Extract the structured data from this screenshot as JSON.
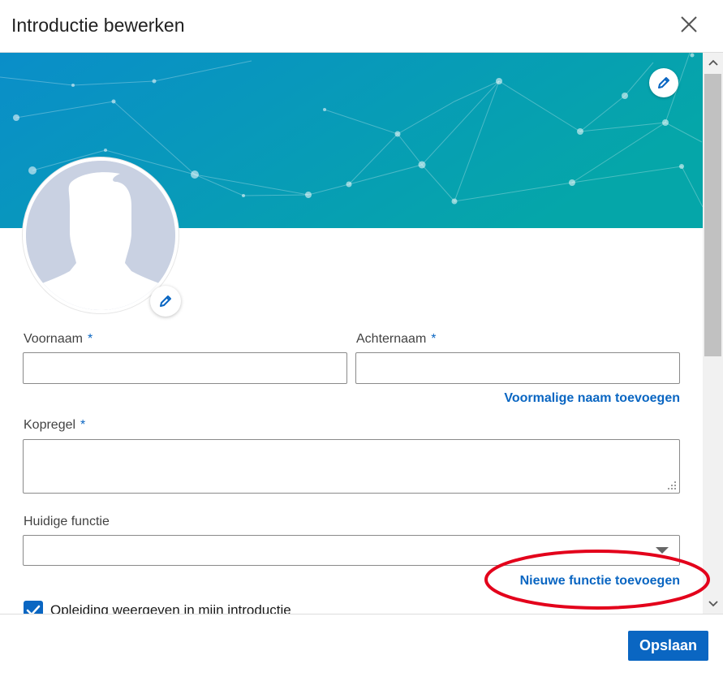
{
  "dialog": {
    "title": "Introductie bewerken"
  },
  "icons": {
    "close": "close-icon",
    "banner_edit": "pencil-icon",
    "avatar_edit": "pencil-icon",
    "checkmark": "checkmark-icon",
    "dropdown": "caret-down-icon"
  },
  "form": {
    "first_name": {
      "label": "Voornaam",
      "required_mark": "*",
      "value": ""
    },
    "last_name": {
      "label": "Achternaam",
      "required_mark": "*",
      "value": ""
    },
    "add_former_name_link": "Voormalige naam toevoegen",
    "headline": {
      "label": "Kopregel",
      "required_mark": "*",
      "value": ""
    },
    "current_position": {
      "label": "Huidige functie",
      "value": ""
    },
    "add_position_link": "Nieuwe functie toevoegen",
    "show_education": {
      "label": "Opleiding weergeven in mijn introductie",
      "checked": true
    }
  },
  "footer": {
    "save_label": "Opslaan"
  },
  "colors": {
    "accent": "#0a66c2",
    "banner_start": "#0a8ec9",
    "banner_end": "#05a6a9",
    "annotation": "#e3001b"
  }
}
